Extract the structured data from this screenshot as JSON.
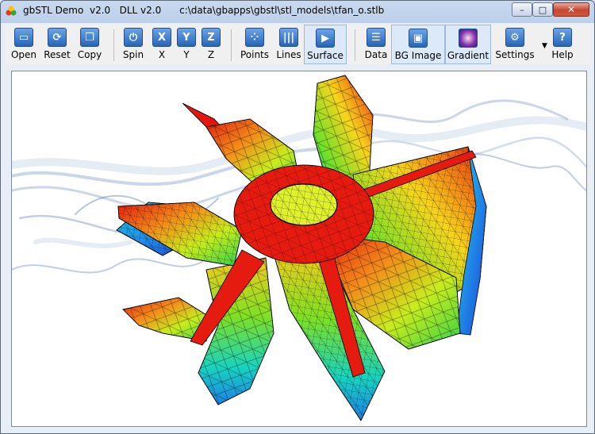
{
  "window": {
    "title": "gbSTL Demo  v2.0   DLL v2.0      c:\\data\\gbapps\\gbstl\\stl_models\\tfan_o.stlb",
    "controls": {
      "minimize": "–",
      "maximize": "□",
      "close": "✕"
    }
  },
  "toolbar": {
    "buttons": [
      {
        "id": "open",
        "label": "Open",
        "icon": "folder-icon"
      },
      {
        "id": "reset",
        "label": "Reset",
        "icon": "refresh-icon"
      },
      {
        "id": "copy",
        "label": "Copy",
        "icon": "copy-icon"
      },
      {
        "id": "spin",
        "label": "Spin",
        "icon": "power-icon"
      },
      {
        "id": "x",
        "label": "X",
        "icon": "rotate-x-icon",
        "glyph": "X"
      },
      {
        "id": "y",
        "label": "Y",
        "icon": "rotate-y-icon",
        "glyph": "Y"
      },
      {
        "id": "z",
        "label": "Z",
        "icon": "rotate-z-icon",
        "glyph": "Z"
      },
      {
        "id": "points",
        "label": "Points",
        "icon": "points-icon"
      },
      {
        "id": "lines",
        "label": "Lines",
        "icon": "lines-icon"
      },
      {
        "id": "surface",
        "label": "Surface",
        "icon": "play-icon"
      },
      {
        "id": "data",
        "label": "Data",
        "icon": "document-icon"
      },
      {
        "id": "bg_image",
        "label": "BG Image",
        "icon": "image-icon"
      },
      {
        "id": "gradient",
        "label": "Gradient",
        "icon": "gradient-icon"
      },
      {
        "id": "settings",
        "label": "Settings",
        "icon": "gear-icon"
      },
      {
        "id": "help",
        "label": "Help",
        "icon": "help-icon",
        "glyph": "?"
      }
    ],
    "active_mode": "Surface"
  },
  "colors": {
    "toolbar_icon": "#2865b8",
    "smoke": "#2f5fa8",
    "model_hot": "#e51b10",
    "model_cold": "#1f6fe0"
  }
}
